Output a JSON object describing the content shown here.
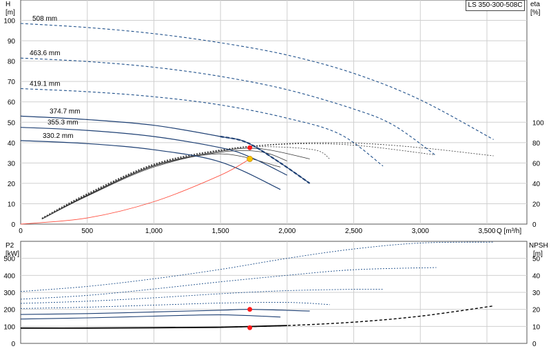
{
  "model_label": "LS 350-300-508C",
  "colors": {
    "dark_blue": "#1d3f73",
    "curve_blue": "#1e4f8a",
    "grid": "#cfcfcf",
    "system_curve": "#ff4a3a",
    "duty_point": "#ff1a1a",
    "yellow_point": "#f5c400"
  },
  "chart_data": [
    {
      "id": "head",
      "type": "line",
      "y_label": "H",
      "y_unit": "[m]",
      "y2_label": "eta",
      "y2_unit": "[%]",
      "x_label": "Q",
      "x_unit": "[m³/h]",
      "xlim": [
        0,
        3800
      ],
      "ylim": [
        0,
        110
      ],
      "y2lim": [
        0,
        100
      ],
      "x_ticks": [
        "0",
        "500",
        "1,000",
        "1,500",
        "2,000",
        "2,500",
        "3,000",
        "3,500"
      ],
      "x_tick_values": [
        0,
        500,
        1000,
        1500,
        2000,
        2500,
        3000,
        3500
      ],
      "y_ticks": [
        0,
        10,
        20,
        30,
        40,
        50,
        60,
        70,
        80,
        90,
        100
      ],
      "y2_ticks": [
        0,
        20,
        40,
        60,
        80,
        100
      ],
      "head_curves": [
        {
          "name": "508 mm",
          "q": [
            0,
            500,
            1000,
            1500,
            2000,
            2500,
            3000,
            3550
          ],
          "h": [
            98.5,
            96.5,
            93.5,
            89,
            83,
            74,
            61,
            41.5
          ]
        },
        {
          "name": "463.6 mm",
          "q": [
            0,
            500,
            1000,
            1500,
            2000,
            2500,
            2800,
            3120
          ],
          "h": [
            81.5,
            79.8,
            77,
            72.5,
            66,
            56.5,
            48.5,
            33.5
          ]
        },
        {
          "name": "419.1 mm",
          "q": [
            0,
            500,
            1000,
            1500,
            2000,
            2400,
            2720
          ],
          "h": [
            66.5,
            65,
            62.5,
            58.5,
            52,
            44,
            28.5
          ]
        },
        {
          "name": "374.7 mm",
          "q": [
            0,
            500,
            1000,
            1500,
            1700,
            1950,
            2170
          ],
          "h": [
            53,
            51.3,
            48.5,
            43,
            40,
            30,
            20
          ]
        },
        {
          "name": "355.3 mm",
          "q": [
            0,
            500,
            1000,
            1500,
            1720,
            2000
          ],
          "h": [
            47.5,
            46,
            43,
            37.5,
            33,
            24
          ]
        },
        {
          "name": "330.2 mm",
          "q": [
            0,
            500,
            1000,
            1500,
            1950
          ],
          "h": [
            41,
            39.5,
            36.5,
            30.5,
            17
          ]
        }
      ],
      "efficiency_curves": [
        {
          "q": [
            160,
            500,
            1000,
            1500,
            2000,
            2500,
            3000,
            3550
          ],
          "eta": [
            6,
            30,
            59,
            73,
            79,
            79.5,
            75,
            67
          ]
        },
        {
          "q": [
            160,
            500,
            1000,
            1500,
            2000,
            2500,
            3110
          ],
          "eta": [
            5.5,
            29.5,
            58.5,
            72.5,
            78.5,
            77.5,
            68
          ]
        },
        {
          "q": [
            160,
            500,
            1000,
            1500,
            1800,
            2200,
            2320
          ],
          "eta": [
            5.5,
            29,
            58,
            72,
            76,
            73,
            64
          ]
        },
        {
          "q": [
            160,
            500,
            1000,
            1500,
            1800,
            2170
          ],
          "eta": [
            5,
            28.5,
            57.5,
            71.5,
            74,
            64
          ]
        },
        {
          "q": [
            160,
            500,
            1000,
            1500,
            1800,
            2000
          ],
          "eta": [
            5,
            28,
            57,
            70.5,
            71,
            62
          ]
        },
        {
          "q": [
            160,
            500,
            1000,
            1500,
            1950
          ],
          "eta": [
            5,
            27.5,
            56,
            69,
            56
          ]
        }
      ],
      "system_curve": {
        "q": [
          0,
          500,
          1000,
          1500,
          1720
        ],
        "h": [
          0,
          3,
          11,
          24,
          32
        ]
      },
      "duty_point": {
        "q": 1720,
        "h": 37.5
      },
      "operating_point": {
        "q": 1720,
        "h": 32
      }
    },
    {
      "id": "power_npsh",
      "type": "line",
      "y_label": "P2",
      "y_unit": "[kW]",
      "y2_label": "NPSH",
      "y2_unit": "[m]",
      "xlim": [
        0,
        3800
      ],
      "ylim": [
        0,
        600
      ],
      "y2lim": [
        0,
        60
      ],
      "y_ticks": [
        0,
        100,
        200,
        300,
        400,
        500
      ],
      "y2_ticks": [
        0,
        10,
        20,
        30,
        40,
        50
      ],
      "power_curves": [
        {
          "q": [
            0,
            500,
            1000,
            1500,
            2000,
            2500,
            3000,
            3550
          ],
          "p": [
            305,
            335,
            380,
            435,
            500,
            555,
            590,
            595
          ]
        },
        {
          "q": [
            0,
            500,
            1000,
            1500,
            2000,
            2500,
            3120
          ],
          "p": [
            260,
            282,
            320,
            362,
            400,
            433,
            446
          ]
        },
        {
          "q": [
            0,
            500,
            1000,
            1500,
            2000,
            2500,
            2720
          ],
          "p": [
            235,
            248,
            268,
            292,
            310,
            318,
            318
          ]
        },
        {
          "q": [
            0,
            500,
            1000,
            1500,
            2000,
            2320
          ],
          "p": [
            205,
            213,
            225,
            237,
            241,
            228
          ]
        },
        {
          "q": [
            0,
            500,
            1000,
            1500,
            1720,
            2170
          ],
          "p": [
            170,
            175,
            185,
            195,
            200,
            190
          ]
        },
        {
          "q": [
            0,
            500,
            1000,
            1500,
            1950
          ],
          "p": [
            143,
            150,
            160,
            168,
            155
          ]
        }
      ],
      "npsh_curve": {
        "q": [
          0,
          500,
          1000,
          1500,
          2000,
          2500,
          3000,
          3550
        ],
        "npsh": [
          9,
          9,
          9.2,
          9.5,
          10.5,
          12.5,
          16,
          22
        ]
      },
      "power_point": {
        "q": 1720,
        "p": 200
      },
      "npsh_point": {
        "q": 1720,
        "npsh": 9.2
      }
    }
  ]
}
